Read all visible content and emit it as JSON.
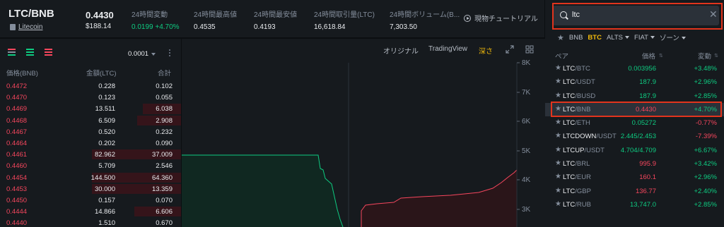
{
  "header": {
    "pair": "LTC/BNB",
    "coin_name": "Litecoin",
    "last_price": "0.4430",
    "last_price_usd": "$188.14",
    "stats": [
      {
        "label": "24時間変動",
        "value": "0.0199 +4.70%",
        "color": "up"
      },
      {
        "label": "24時間最高値",
        "value": "0.4535",
        "color": ""
      },
      {
        "label": "24時間最安値",
        "value": "0.4193",
        "color": ""
      },
      {
        "label": "24時間取引量(LTC)",
        "value": "16,618.84",
        "color": ""
      },
      {
        "label": "24時間ボリューム(B...",
        "value": "7,303.50",
        "color": ""
      }
    ],
    "tutorial_label": "現物チュートリアル"
  },
  "orderbook": {
    "precision": "0.0001",
    "col_price": "価格(BNB)",
    "col_amount": "金額(LTC)",
    "col_total": "合計",
    "rows": [
      {
        "price": "0.4472",
        "amount": "0.228",
        "total": "0.102",
        "depth": 0.0
      },
      {
        "price": "0.4470",
        "amount": "0.123",
        "total": "0.055",
        "depth": 0.0
      },
      {
        "price": "0.4469",
        "amount": "13.511",
        "total": "6.038",
        "depth": 0.43
      },
      {
        "price": "0.4468",
        "amount": "6.509",
        "total": "2.908",
        "depth": 0.49
      },
      {
        "price": "0.4467",
        "amount": "0.520",
        "total": "0.232",
        "depth": 0.0
      },
      {
        "price": "0.4464",
        "amount": "0.202",
        "total": "0.090",
        "depth": 0.0
      },
      {
        "price": "0.4461",
        "amount": "82.962",
        "total": "37.009",
        "depth": 1.0
      },
      {
        "price": "0.4460",
        "amount": "5.709",
        "total": "2.546",
        "depth": 0.0
      },
      {
        "price": "0.4454",
        "amount": "144.500",
        "total": "64.360",
        "depth": 1.0
      },
      {
        "price": "0.4453",
        "amount": "30.000",
        "total": "13.359",
        "depth": 1.0
      },
      {
        "price": "0.4450",
        "amount": "0.157",
        "total": "0.070",
        "depth": 0.0
      },
      {
        "price": "0.4444",
        "amount": "14.866",
        "total": "6.606",
        "depth": 0.52
      },
      {
        "price": "0.4440",
        "amount": "1.510",
        "total": "0.670",
        "depth": 0.0
      }
    ]
  },
  "chart": {
    "tabs": [
      "オリジナル",
      "TradingView",
      "深さ"
    ],
    "active_tab": "深さ",
    "y_ticks": [
      "8K",
      "7K",
      "6K",
      "5K",
      "4K",
      "3K"
    ]
  },
  "markets": {
    "search_value": "ltc",
    "filters": [
      "BNB",
      "BTC",
      "ALTS",
      "FIAT",
      "ゾーン"
    ],
    "active_filter": "BTC",
    "col_pair": "ペア",
    "col_price": "価格",
    "col_change": "変動",
    "rows": [
      {
        "base": "LTC",
        "quote": "/BTC",
        "price": "0.003956",
        "change": "+3.48%",
        "dir": "up"
      },
      {
        "base": "LTC",
        "quote": "/USDT",
        "price": "187.9",
        "change": "+2.96%",
        "dir": "up"
      },
      {
        "base": "LTC",
        "quote": "/BUSD",
        "price": "187.9",
        "change": "+2.85%",
        "dir": "up"
      },
      {
        "base": "LTC",
        "quote": "/BNB",
        "price": "0.4430",
        "change": "+4.70%",
        "dir": "up",
        "price_dir": "dn",
        "selected": true
      },
      {
        "base": "LTC",
        "quote": "/ETH",
        "price": "0.05272",
        "change": "-0.77%",
        "dir": "dn"
      },
      {
        "base": "LTCDOWN",
        "quote": "/USDT",
        "price": "2.445/2.453",
        "change": "-7.39%",
        "dir": "dn"
      },
      {
        "base": "LTCUP",
        "quote": "/USDT",
        "price": "4.704/4.709",
        "change": "+6.67%",
        "dir": "up"
      },
      {
        "base": "LTC",
        "quote": "/BRL",
        "price": "995.9",
        "change": "+3.42%",
        "dir": "up",
        "price_dir": "dn"
      },
      {
        "base": "LTC",
        "quote": "/EUR",
        "price": "160.1",
        "change": "+2.96%",
        "dir": "up",
        "price_dir": "dn"
      },
      {
        "base": "LTC",
        "quote": "/GBP",
        "price": "136.77",
        "change": "+2.40%",
        "dir": "up",
        "price_dir": "dn"
      },
      {
        "base": "LTC",
        "quote": "/RUB",
        "price": "13,747.0",
        "change": "+2.85%",
        "dir": "up"
      }
    ]
  },
  "colors": {
    "up": "#0ecb81",
    "down": "#f6465d",
    "accent": "#f0b90b",
    "highlight": "#e2341d"
  }
}
